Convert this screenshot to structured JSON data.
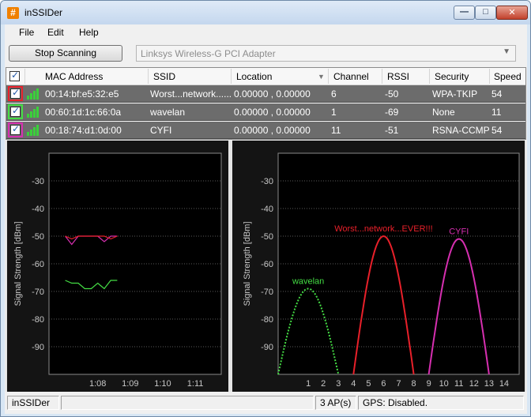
{
  "window": {
    "title": "inSSIDer",
    "app_icon": "hash-icon",
    "min_glyph": "—",
    "max_glyph": "□",
    "close_glyph": "✕"
  },
  "menu": {
    "file": "File",
    "edit": "Edit",
    "help": "Help"
  },
  "toolbar": {
    "stop_label": "Stop Scanning",
    "adapter_value": "Linksys Wireless-G PCI Adapter"
  },
  "table": {
    "columns": [
      "MAC Address",
      "SSID",
      "Location",
      "Channel",
      "RSSI",
      "Security",
      "Speed"
    ],
    "rows": [
      {
        "color": "#e8202a",
        "mac": "00:14:bf:e5:32:e5",
        "ssid": "Worst...network......",
        "location": "0.00000 , 0.00000",
        "channel": "6",
        "rssi": "-50",
        "security": "WPA-TKIP",
        "speed": "54"
      },
      {
        "color": "#44dd44",
        "mac": "00:60:1d:1c:66:0a",
        "ssid": "wavelan",
        "location": "0.00000 , 0.00000",
        "channel": "1",
        "rssi": "-69",
        "security": "None",
        "speed": "11"
      },
      {
        "color": "#d62fb0",
        "mac": "00:18:74:d1:0d:00",
        "ssid": "CYFI",
        "location": "0.00000 , 0.00000",
        "channel": "11",
        "rssi": "-51",
        "security": "RSNA-CCMP",
        "speed": "54"
      }
    ]
  },
  "chart_data": [
    {
      "type": "line",
      "title": "",
      "xlabel": "",
      "ylabel": "Signal Strength [dBm]",
      "ylim": [
        -100,
        -20
      ],
      "yticks": [
        "-30",
        "-40",
        "-50",
        "-60",
        "-70",
        "-80",
        "-90"
      ],
      "xticks": [
        "1:08",
        "1:09",
        "1:10",
        "1:11"
      ],
      "grid": true,
      "series": [
        {
          "color": "#d62fb0",
          "x": [
            0,
            0.2,
            0.4,
            0.6,
            0.8,
            1.0,
            1.2,
            1.4,
            1.6
          ],
          "y": [
            -50,
            -53,
            -50,
            -50,
            -50,
            -50,
            -52,
            -50,
            -50
          ]
        },
        {
          "color": "#e8202a",
          "x": [
            0,
            0.2,
            0.4,
            0.6,
            0.8,
            1.0,
            1.2,
            1.4,
            1.6
          ],
          "y": [
            -50,
            -51,
            -50,
            -50,
            -50,
            -50,
            -50,
            -51,
            -50
          ]
        },
        {
          "color": "#44dd44",
          "x": [
            0,
            0.2,
            0.4,
            0.6,
            0.8,
            1.0,
            1.2,
            1.4,
            1.6
          ],
          "y": [
            -66,
            -67,
            -67,
            -69,
            -69,
            -67,
            -69,
            -66,
            -66
          ]
        }
      ]
    },
    {
      "type": "area",
      "title": "",
      "xlabel": "",
      "ylabel": "Signal Strength [dBm]",
      "ylim": [
        -100,
        -20
      ],
      "xlim": [
        -1,
        15
      ],
      "yticks": [
        "-30",
        "-40",
        "-50",
        "-60",
        "-70",
        "-80",
        "-90"
      ],
      "xticks": [
        "1",
        "2",
        "3",
        "4",
        "5",
        "6",
        "7",
        "8",
        "9",
        "10",
        "11",
        "12",
        "13",
        "14"
      ],
      "grid": true,
      "series": [
        {
          "name": "wavelan",
          "channel": 1,
          "rssi": -69,
          "color": "#44dd44",
          "style": "dotted"
        },
        {
          "name": "Worst...network...EVER!!!",
          "channel": 6,
          "rssi": -50,
          "color": "#e8202a",
          "style": "solid"
        },
        {
          "name": "CYFI",
          "channel": 11,
          "rssi": -51,
          "color": "#d62fb0",
          "style": "solid"
        }
      ]
    }
  ],
  "status": {
    "app": "inSSIDer",
    "progress": "",
    "ap_count": "3 AP(s)",
    "gps": "GPS: Disabled."
  }
}
